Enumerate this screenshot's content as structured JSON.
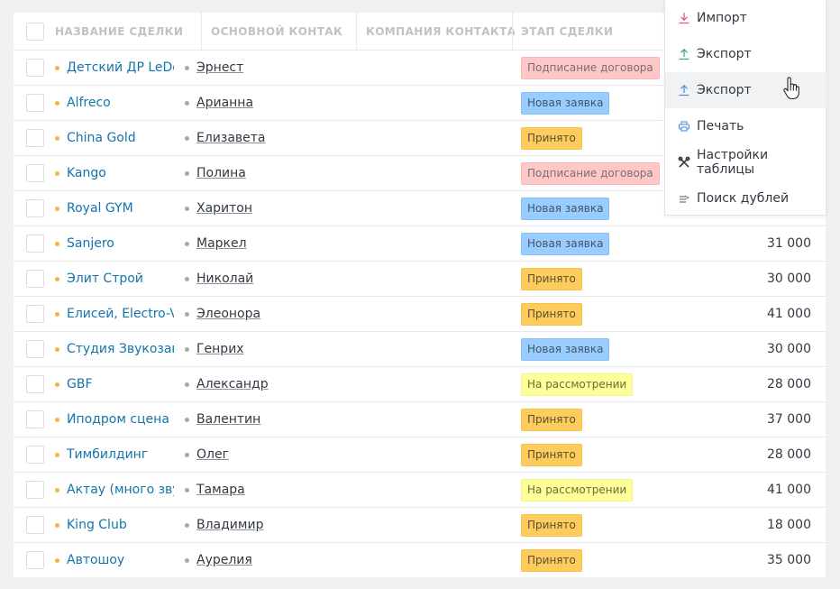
{
  "table": {
    "headers": {
      "name": "НАЗВАНИЕ СДЕЛКИ",
      "contact": "ОСНОВНОЙ КОНТАК",
      "company": "КОМПАНИЯ КОНТАКТА",
      "stage": "ЭТАП СДЕЛКИ"
    },
    "rows": [
      {
        "name": "Детский ДР LeDom",
        "contact": "Эрнест",
        "company": "",
        "stage": "Подписание договора",
        "stage_type": "podp",
        "budget": ""
      },
      {
        "name": "Alfreco",
        "contact": "Арианна",
        "company": "",
        "stage": "Новая заявка",
        "stage_type": "new",
        "budget": ""
      },
      {
        "name": "China Gold",
        "contact": "Елизавета",
        "company": "",
        "stage": "Принято",
        "stage_type": "ok",
        "budget": ""
      },
      {
        "name": "Kango",
        "contact": "Полина",
        "company": "",
        "stage": "Подписание договора",
        "stage_type": "podp",
        "budget": ""
      },
      {
        "name": "Royal GYM",
        "contact": "Харитон",
        "company": "",
        "stage": "Новая заявка",
        "stage_type": "new",
        "budget": ""
      },
      {
        "name": "Sanjero",
        "contact": "Маркел",
        "company": "",
        "stage": "Новая заявка",
        "stage_type": "new",
        "budget": "31 000"
      },
      {
        "name": "Элит Строй",
        "contact": "Николай",
        "company": "",
        "stage": "Принято",
        "stage_type": "ok",
        "budget": "30 000"
      },
      {
        "name": "Елисей, Electro-Voi",
        "contact": "Элеонора",
        "company": "",
        "stage": "Принято",
        "stage_type": "ok",
        "budget": "41 000"
      },
      {
        "name": "Студия Звукозапис",
        "contact": "Генрих",
        "company": "",
        "stage": "Новая заявка",
        "stage_type": "new",
        "budget": "30 000"
      },
      {
        "name": "GBF",
        "contact": "Александр",
        "company": "",
        "stage": "На рассмотрении",
        "stage_type": "rev",
        "budget": "28 000"
      },
      {
        "name": "Иподром сцена",
        "contact": "Валентин",
        "company": "",
        "stage": "Принято",
        "stage_type": "ok",
        "budget": "37 000"
      },
      {
        "name": "Тимбилдинг",
        "contact": "Олег",
        "company": "",
        "stage": "Принято",
        "stage_type": "ok",
        "budget": "28 000"
      },
      {
        "name": "Актау (много звука",
        "contact": "Тамара",
        "company": "",
        "stage": "На рассмотрении",
        "stage_type": "rev",
        "budget": "41 000"
      },
      {
        "name": "King Club",
        "contact": "Владимир",
        "company": "",
        "stage": "Принято",
        "stage_type": "ok",
        "budget": "18 000"
      },
      {
        "name": "Автошоу",
        "contact": "Аурелия",
        "company": "",
        "stage": "Принято",
        "stage_type": "ok",
        "budget": "35 000"
      }
    ]
  },
  "menu": {
    "items": [
      {
        "label": "Импорт",
        "icon": "download-arrow-icon",
        "color": "#e05080"
      },
      {
        "label": "Экспорт",
        "icon": "upload-arrow-icon",
        "color": "#35a86b"
      },
      {
        "label": "Экспорт",
        "icon": "upload-arrow-icon",
        "color": "#4a8fd6",
        "hover": true
      },
      {
        "label": "Печать",
        "icon": "printer-icon",
        "color": "#4a8fd6"
      },
      {
        "label": "Настройки таблицы",
        "icon": "tools-icon",
        "color": "#313942"
      },
      {
        "label": "Поиск дублей",
        "icon": "duplicates-icon",
        "color": "#8a9096"
      }
    ]
  }
}
